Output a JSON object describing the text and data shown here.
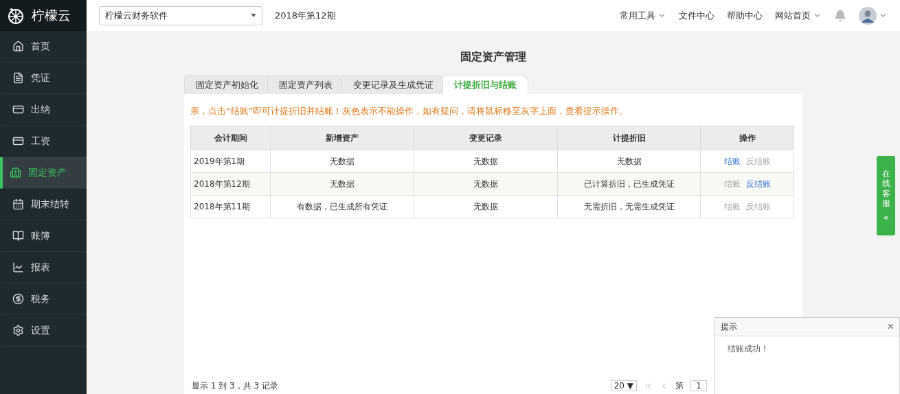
{
  "brand": {
    "name": "柠檬云"
  },
  "sidebar": {
    "items": [
      {
        "label": "首页",
        "selected": false
      },
      {
        "label": "凭证",
        "selected": false
      },
      {
        "label": "出纳",
        "selected": false
      },
      {
        "label": "工资",
        "selected": false
      },
      {
        "label": "固定资产",
        "selected": true
      },
      {
        "label": "期末结转",
        "selected": false
      },
      {
        "label": "账簿",
        "selected": false
      },
      {
        "label": "报表",
        "selected": false
      },
      {
        "label": "税务",
        "selected": false
      },
      {
        "label": "设置",
        "selected": false
      }
    ]
  },
  "topbar": {
    "account_select": "柠檬云财务软件",
    "period": "2018年第12期",
    "links": [
      {
        "label": "常用工具",
        "dropdown": true
      },
      {
        "label": "文件中心",
        "dropdown": false
      },
      {
        "label": "帮助中心",
        "dropdown": false
      },
      {
        "label": "网站首页",
        "dropdown": true
      }
    ]
  },
  "page_title": "固定资产管理",
  "tabs": [
    {
      "label": "固定资产初始化",
      "selected": false
    },
    {
      "label": "固定资产列表",
      "selected": false
    },
    {
      "label": "变更记录及生成凭证",
      "selected": false
    },
    {
      "label": "计提折旧与结账",
      "selected": true
    }
  ],
  "notice": "亲，点击“结账”即可计提折旧并结账！灰色表示不能操作，如有疑问，请将鼠标移至灰字上面，查看提示操作。",
  "table": {
    "columns": [
      "会计期间",
      "新增资产",
      "变更记录",
      "计提折旧",
      "操作"
    ],
    "rows": [
      {
        "period": "2019年第1期",
        "new_assets": "无数据",
        "changes": "无数据",
        "depreciation": "无数据",
        "actions": [
          {
            "label": "结账",
            "enabled": true
          },
          {
            "label": "反结账",
            "enabled": false
          }
        ]
      },
      {
        "period": "2018年第12期",
        "new_assets": "无数据",
        "changes": "无数据",
        "depreciation": "已计算折旧，已生成凭证",
        "actions": [
          {
            "label": "结账",
            "enabled": false
          },
          {
            "label": "反结账",
            "enabled": true
          }
        ]
      },
      {
        "period": "2018年第11期",
        "new_assets": "有数据，已生成所有凭证",
        "changes": "无数据",
        "depreciation": "无需折旧，无需生成凭证",
        "actions": [
          {
            "label": "结账",
            "enabled": false
          },
          {
            "label": "反结账",
            "enabled": false
          }
        ]
      }
    ]
  },
  "footer": {
    "summary": "显示 1 到 3，共 3 记录",
    "page_size": "20 ▼",
    "page_label": "第",
    "page": "1"
  },
  "service_tab": {
    "label": "在线客服",
    "arrow": "«"
  },
  "dialog": {
    "title": "提示",
    "close": "×",
    "message": "结账成功！"
  }
}
